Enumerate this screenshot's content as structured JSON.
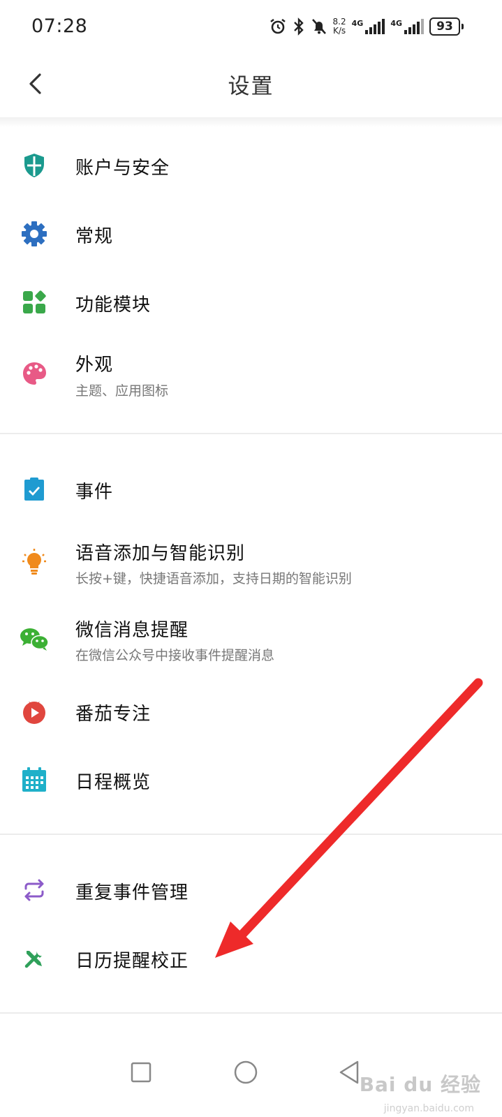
{
  "status_bar": {
    "time": "07:28",
    "net_speed_value": "8.2",
    "net_speed_unit": "K/s",
    "sim1_label": "4G",
    "sim2_label": "4G",
    "battery_level": "93"
  },
  "header": {
    "title": "设置",
    "back_icon": "chevron-left-icon"
  },
  "settings": {
    "group1": [
      {
        "label": "账户与安全",
        "icon": "shield-icon",
        "color": "#1b9a8e"
      },
      {
        "label": "常规",
        "icon": "gear-icon",
        "color": "#2d6fc0"
      },
      {
        "label": "功能模块",
        "icon": "modules-icon",
        "color": "#3aa84a"
      },
      {
        "label": "外观",
        "subtitle": "主题、应用图标",
        "icon": "palette-icon",
        "color": "#e85a86"
      }
    ],
    "group2": [
      {
        "label": "事件",
        "icon": "clipboard-check-icon",
        "color": "#1f9bd1"
      },
      {
        "label": "语音添加与智能识别",
        "subtitle": "长按+键，快捷语音添加，支持日期的智能识别",
        "icon": "lightbulb-icon",
        "color": "#f08a1c"
      },
      {
        "label": "微信消息提醒",
        "subtitle": "在微信公众号中接收事件提醒消息",
        "icon": "wechat-icon",
        "color": "#3cb034"
      },
      {
        "label": "番茄专注",
        "icon": "tomato-timer-icon",
        "color": "#e0463e"
      },
      {
        "label": "日程概览",
        "icon": "calendar-icon",
        "color": "#1fb0c9"
      }
    ],
    "group3": [
      {
        "label": "重复事件管理",
        "icon": "repeat-icon",
        "color": "#8c5bc9"
      },
      {
        "label": "日历提醒校正",
        "icon": "tools-icon",
        "color": "#2fa05a"
      }
    ]
  },
  "annotation": {
    "arrow_color": "#ee2a2a"
  },
  "nav_bar": {
    "recent_icon": "square-icon",
    "home_icon": "circle-icon",
    "back_icon": "triangle-back-icon"
  },
  "watermark": {
    "text": "Bai du 经验",
    "url": "jingyan.baidu.com"
  }
}
